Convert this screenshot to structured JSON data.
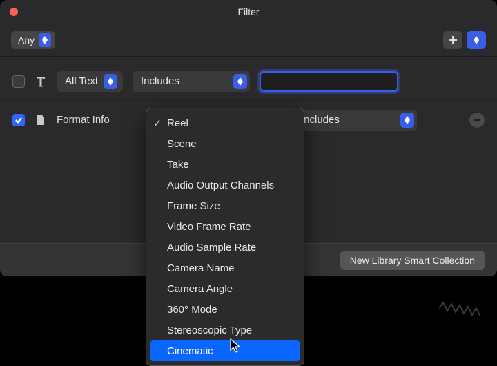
{
  "window": {
    "title": "Filter"
  },
  "toolbar": {
    "match": "Any"
  },
  "rows": {
    "text": {
      "field": "All Text",
      "condition": "Includes",
      "value": ""
    },
    "format": {
      "label": "Format Info",
      "condition": "Includes"
    }
  },
  "menu": {
    "items": [
      "Reel",
      "Scene",
      "Take",
      "Audio Output Channels",
      "Frame Size",
      "Video Frame Rate",
      "Audio Sample Rate",
      "Camera Name",
      "Camera Angle",
      "360° Mode",
      "Stereoscopic Type",
      "Cinematic"
    ],
    "selected_index": 0,
    "highlighted_index": 11
  },
  "footer": {
    "button": "New Library Smart Collection"
  }
}
